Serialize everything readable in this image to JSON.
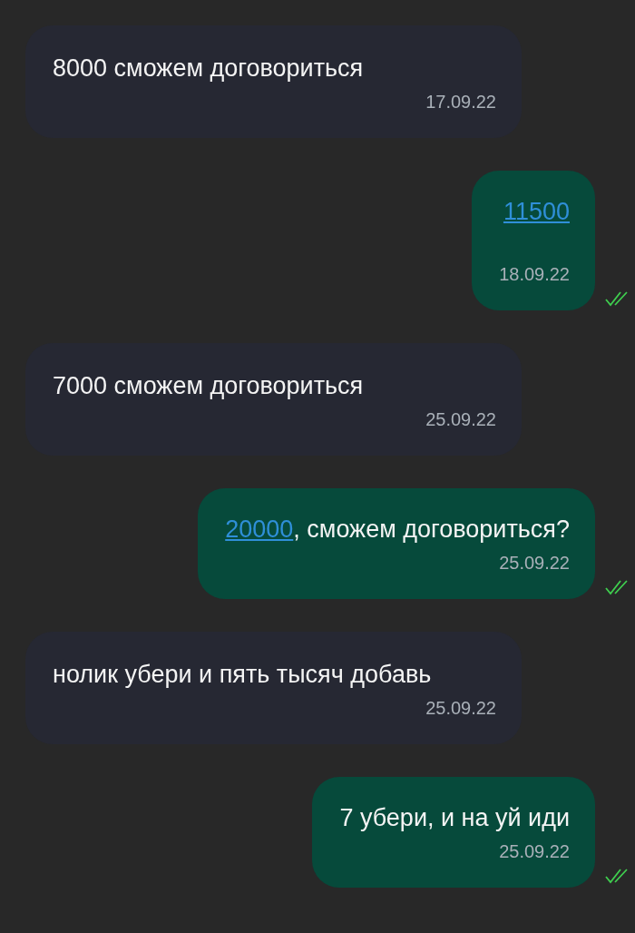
{
  "messages": [
    {
      "kind": "incoming",
      "parts": [
        {
          "kind": "plain",
          "text": "8000 сможем договориться"
        }
      ],
      "date": "17.09.22"
    },
    {
      "kind": "outgoing",
      "parts": [
        {
          "kind": "link",
          "text": "11500"
        }
      ],
      "date": "18.09.22",
      "read": true
    },
    {
      "kind": "incoming",
      "parts": [
        {
          "kind": "plain",
          "text": "7000 сможем договориться"
        }
      ],
      "date": "25.09.22"
    },
    {
      "kind": "outgoing",
      "parts": [
        {
          "kind": "link",
          "text": "20000"
        },
        {
          "kind": "plain",
          "text": ", сможем договориться?"
        }
      ],
      "date": "25.09.22",
      "read": true
    },
    {
      "kind": "incoming",
      "parts": [
        {
          "kind": "plain",
          "text": "нолик убери и пять тысяч добавь"
        }
      ],
      "date": "25.09.22"
    },
    {
      "kind": "outgoing",
      "parts": [
        {
          "kind": "plain",
          "text": "7 убери, и на уй иди"
        }
      ],
      "date": "25.09.22",
      "read": true
    }
  ]
}
